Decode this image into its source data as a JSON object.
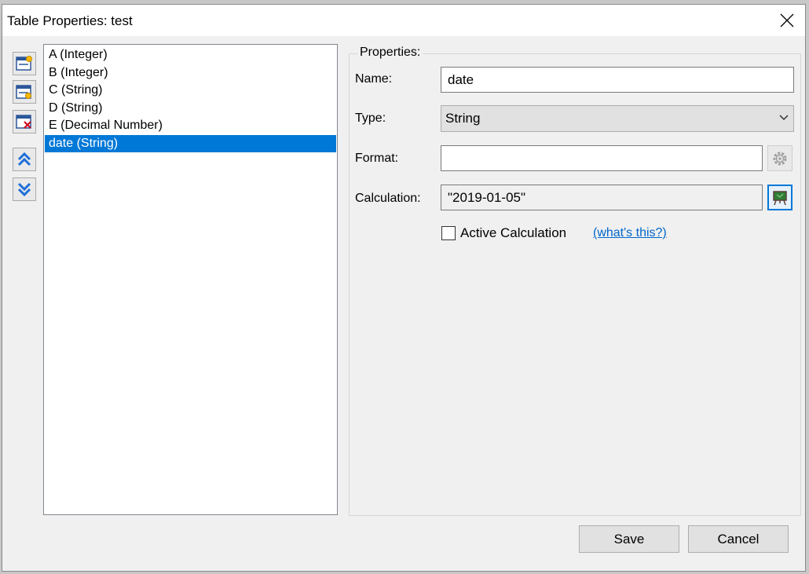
{
  "window": {
    "title": "Table Properties: test"
  },
  "columns": {
    "items": [
      {
        "label": "A (Integer)"
      },
      {
        "label": "B (Integer)"
      },
      {
        "label": "C (String)"
      },
      {
        "label": "D (String)"
      },
      {
        "label": "E (Decimal Number)"
      },
      {
        "label": "date (String)"
      }
    ],
    "selected_index": 5
  },
  "toolbar": {
    "icons": [
      "add-column-icon",
      "edit-column-icon",
      "delete-column-icon",
      "move-up-icon",
      "move-down-icon"
    ]
  },
  "properties": {
    "group_title": "Properties:",
    "name_label": "Name:",
    "name_value": "date",
    "type_label": "Type:",
    "type_value": "String",
    "format_label": "Format:",
    "format_value": "",
    "calculation_label": "Calculation:",
    "calculation_value": "\"2019-01-05\"",
    "active_calculation_label": "Active Calculation",
    "active_calculation_checked": false,
    "whats_this_link": "(what's this?)"
  },
  "buttons": {
    "save": "Save",
    "cancel": "Cancel"
  },
  "colors": {
    "selection": "#0078d7",
    "link": "#0066cc"
  }
}
